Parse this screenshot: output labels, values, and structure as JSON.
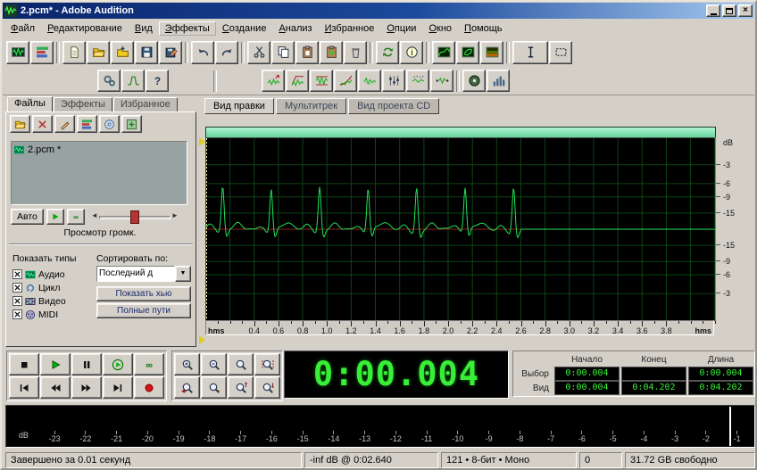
{
  "window": {
    "title": "2.pcm* - Adobe Audition"
  },
  "menu": {
    "items": [
      "Файл",
      "Редактирование",
      "Вид",
      "Эффекты",
      "Создание",
      "Анализ",
      "Избранное",
      "Опции",
      "Окно",
      "Помощь"
    ],
    "active_item": "Эффекты"
  },
  "toolbar_row1": {
    "groups": [
      {
        "name": "views",
        "icons": [
          "waveform-view",
          "multitrack-view"
        ]
      },
      {
        "name": "files",
        "icons": [
          "new-file",
          "open-file",
          "import-file",
          "save-file",
          "save-as"
        ]
      },
      {
        "name": "history",
        "icons": [
          "undo",
          "redo"
        ]
      },
      {
        "name": "clipboard",
        "icons": [
          "cut",
          "copy",
          "paste",
          "mix-paste",
          "delete"
        ]
      },
      {
        "name": "convert",
        "icons": [
          "convert-sample-type",
          "file-info"
        ]
      },
      {
        "name": "analysis",
        "icons": [
          "frequency-analysis",
          "phase-analysis",
          "spectral-view"
        ]
      },
      {
        "name": "tools",
        "icons": [
          "time-selection-tool",
          "marquee-tool"
        ]
      }
    ]
  },
  "toolbar_row2": {
    "groups": [
      {
        "name": "effects",
        "icons": [
          "effects-rack",
          "generate",
          "scripts-help"
        ]
      },
      {
        "name": "process",
        "icons": [
          "amplify",
          "envelope",
          "normalize",
          "fade",
          "echo",
          "equalizer",
          "noise-reduction",
          "stretch"
        ]
      },
      {
        "name": "master",
        "icons": [
          "mastering",
          "analyze-stats"
        ]
      }
    ]
  },
  "left_panel": {
    "tabs": [
      {
        "label": "Файлы",
        "active": true
      },
      {
        "label": "Эффекты",
        "active": false
      },
      {
        "label": "Избранное",
        "active": false
      }
    ],
    "toolbar_icons": [
      "open-file-small",
      "delete-file",
      "edit-file",
      "insert-multitrack",
      "insert-cd",
      "advanced-options"
    ],
    "files": [
      {
        "icon": "audio-file",
        "name": "2.pcm *"
      }
    ],
    "auto_label": "Авто",
    "volume_label": "Просмотр громк.",
    "show_types_label": "Показать типы",
    "sort_label": "Сортировать по:",
    "sort_value": "Последний д",
    "file_types": [
      {
        "icon": "type-audio",
        "label": "Аудио",
        "checked": true
      },
      {
        "icon": "type-loop",
        "label": "Цикл",
        "checked": true
      },
      {
        "icon": "type-video",
        "label": "Видео",
        "checked": true
      },
      {
        "icon": "type-midi",
        "label": "MIDI",
        "checked": true
      }
    ],
    "advanced_buttons": [
      "Показать хью",
      "Полные пути"
    ]
  },
  "view_tabs": [
    {
      "label": "Вид правки",
      "active": true
    },
    {
      "label": "Мультитрек",
      "active": false
    },
    {
      "label": "Вид проекта CD",
      "active": false
    }
  ],
  "waveform": {
    "time_start": 0.004,
    "time_end": 4.202,
    "db_labels": [
      "dB",
      "-3",
      "-6",
      "-9",
      "-15",
      "-15",
      "-9",
      "-6",
      "-3"
    ],
    "timeline_labels": [
      "0.4",
      "0.6",
      "0.8",
      "1.0",
      "1.2",
      "1.4",
      "1.6",
      "1.8",
      "2.0",
      "2.2",
      "2.4",
      "2.6",
      "2.8",
      "3.0",
      "3.2",
      "3.4",
      "3.6",
      "3.8"
    ],
    "timeline_unit": "hms",
    "beats": [
      0.14,
      0.54,
      0.94,
      1.34,
      1.74,
      2.14,
      2.54
    ],
    "silence_after": 2.6,
    "colors": {
      "background": "#000000",
      "grid": "#0e4414",
      "trace": "#1fe357",
      "center_line": "#8c1f1f",
      "overview_bar": "#7ae8b4"
    }
  },
  "transport": {
    "row1": [
      "stop",
      "play",
      "pause",
      "play-looped",
      "loop"
    ],
    "row2": [
      "go-to-start",
      "rewind",
      "fast-forward",
      "go-to-end",
      "record"
    ]
  },
  "zoom": {
    "row1": [
      "zoom-in",
      "zoom-out",
      "zoom-full",
      "zoom-selection"
    ],
    "row2": [
      "zoom-left-edge",
      "zoom-right-edge",
      "zoom-in-vertical",
      "zoom-out-vertical"
    ]
  },
  "time_display": "0:00.004",
  "selection_view": {
    "columns": [
      "Начало",
      "Конец",
      "Длина"
    ],
    "rows": [
      {
        "label": "Выбор",
        "values": [
          "0:00.004",
          "",
          "0:00.004"
        ]
      },
      {
        "label": "Вид",
        "values": [
          "0:00.004",
          "0:04.202",
          "0:04.202"
        ]
      }
    ]
  },
  "level_meter": {
    "labels": [
      "dB",
      "-23",
      "-22",
      "-21",
      "-20",
      "-19",
      "-18",
      "-17",
      "-16",
      "-15",
      "-14",
      "-13",
      "-12",
      "-11",
      "-10",
      "-9",
      "-8",
      "-7",
      "-6",
      "-5",
      "-4",
      "-3",
      "-2",
      "-1"
    ]
  },
  "status_bar": {
    "segments": [
      "Завершено за 0.01 секунд",
      "-inf dB @ 0:02.640",
      "121 • 8-бит • Моно",
      "0",
      "31.72 GB свободно"
    ]
  }
}
